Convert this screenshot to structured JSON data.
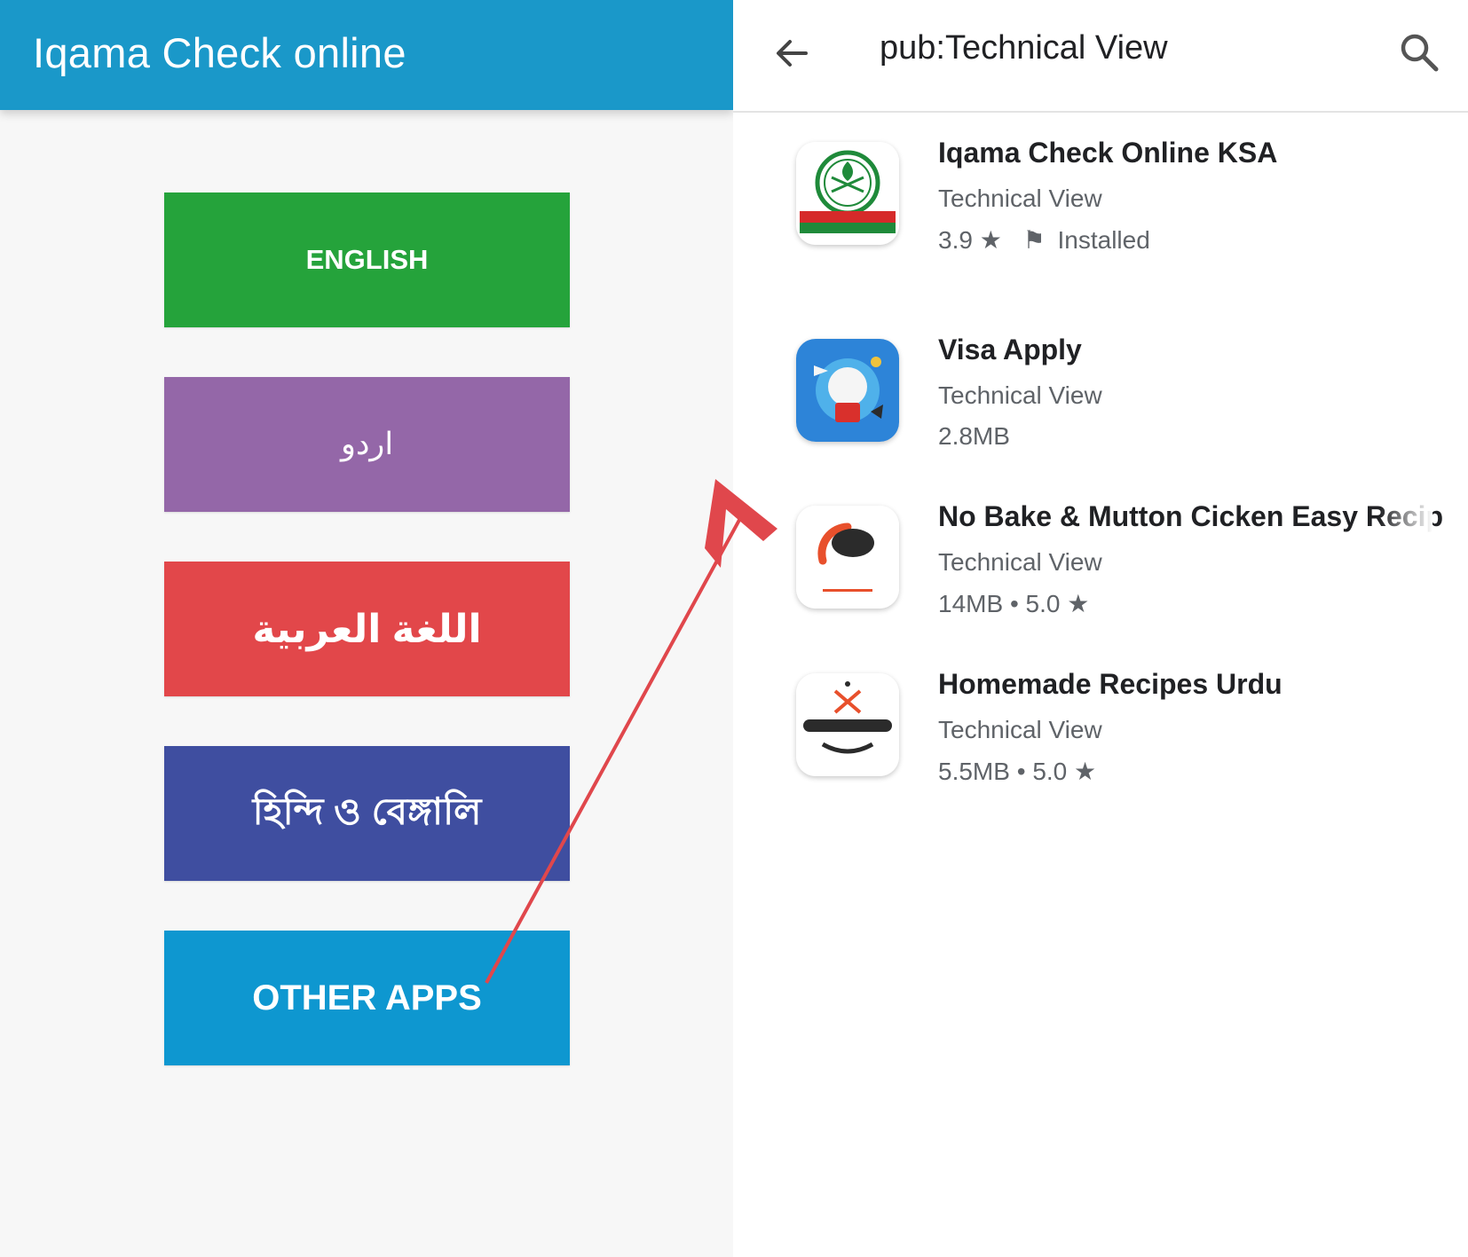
{
  "left_app": {
    "title": "Iqama Check online",
    "buttons": {
      "english": "ENGLISH",
      "urdu": "اردو",
      "arabic": "اللغة العربية",
      "hindi_bengali": "হিন্দি ও বেঙ্গালি",
      "other_apps": "OTHER APPS"
    },
    "colors": {
      "appbar": "#1a98c9",
      "english": "#25a33b",
      "urdu": "#9467a8",
      "arabic": "#e2474a",
      "hindi_bengali": "#3f4ea0",
      "other_apps": "#0e97d0"
    }
  },
  "store": {
    "search_query": "pub:Technical View",
    "back_icon": "arrow-left-icon",
    "search_icon": "magnifier-icon",
    "results": [
      {
        "name": "Iqama Check Online KSA",
        "developer": "Technical View",
        "rating": "3.9",
        "installed_label": "Installed",
        "icon": "saudi-emblem-icon"
      },
      {
        "name": "Visa Apply",
        "developer": "Technical View",
        "size": "2.8MB",
        "icon": "travel-world-icon"
      },
      {
        "name": "No Bake & Mutton Cicken Easy Recip",
        "developer": "Technical View",
        "size": "14MB",
        "rating": "5.0",
        "icon": "pizza-burger-icon"
      },
      {
        "name": "Homemade Recipes Urdu",
        "developer": "Technical View",
        "size": "5.5MB",
        "rating": "5.0",
        "icon": "chef-recipes-icon"
      }
    ]
  },
  "annotation": {
    "arrow_color": "#e0474c"
  }
}
